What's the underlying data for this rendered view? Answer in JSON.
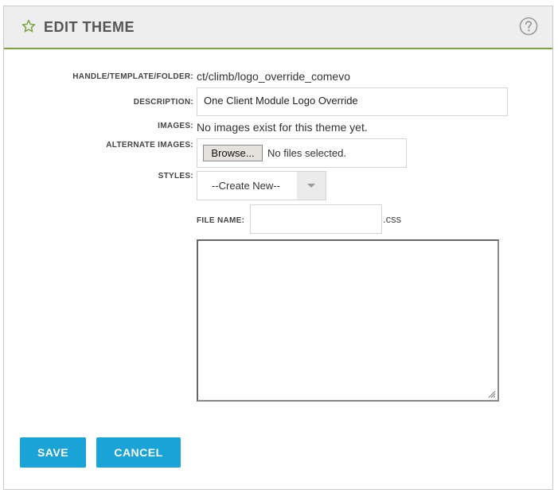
{
  "header": {
    "title": "EDIT THEME",
    "star_icon": "star-outline-icon",
    "help_icon": "question-circle-icon"
  },
  "form": {
    "handle_label": "HANDLE/TEMPLATE/FOLDER:",
    "handle_value": "ct/climb/logo_override_comevo",
    "description_label": "DESCRIPTION:",
    "description_value": "One Client Module Logo Override",
    "images_label": "IMAGES:",
    "images_value": "No images exist for this theme yet.",
    "alt_images_label": "ALTERNATE IMAGES:",
    "browse_label": "Browse...",
    "no_files_label": "No files selected.",
    "styles_label": "STYLES:",
    "styles_selected": "--Create New--",
    "file_name_label": "FILE NAME:",
    "file_name_value": "",
    "file_ext": ".css",
    "css_content": ""
  },
  "actions": {
    "save_label": "SAVE",
    "cancel_label": "CANCEL"
  },
  "colors": {
    "accent": "#1aa3d6",
    "header_border": "#7fa340",
    "header_bg": "#eeeeee"
  }
}
